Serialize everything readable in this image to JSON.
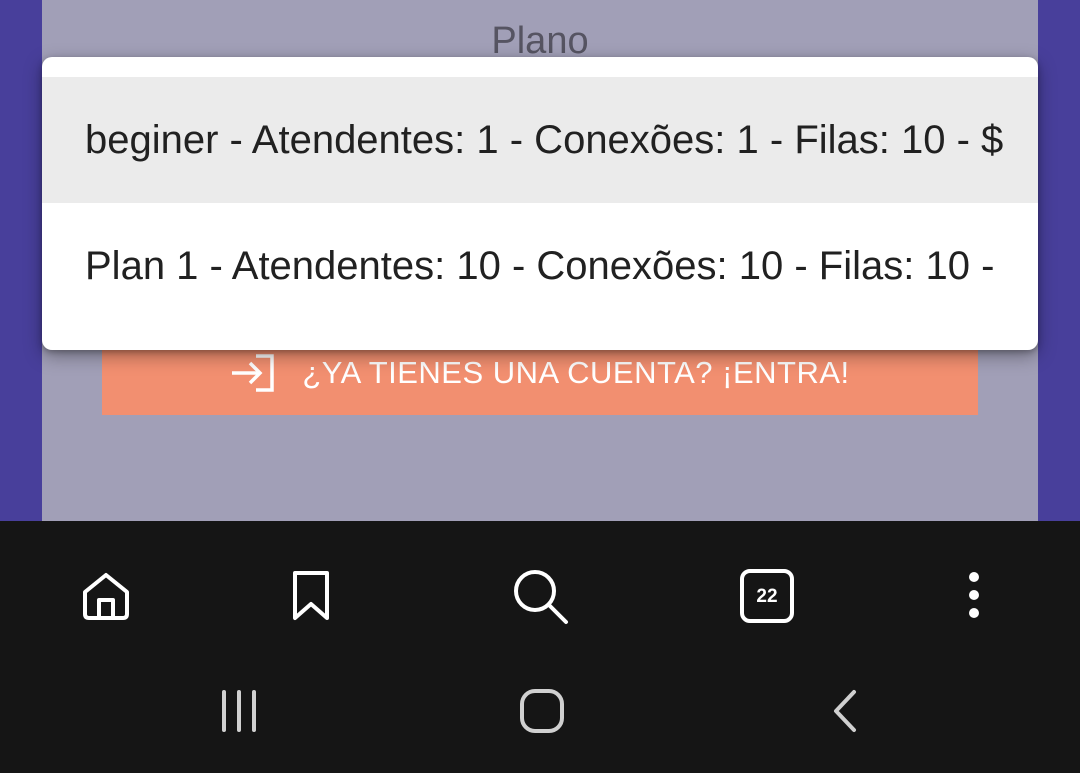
{
  "form": {
    "plan_label": "Plano",
    "login_button_label": "¿YA TIENES UNA CUENTA? ¡ENTRA!",
    "login_icon": "login-arrow-icon"
  },
  "plan_dropdown": {
    "options": [
      {
        "label": "beginer - Atendentes: 1 - Conexões: 1 - Filas: 10 - $",
        "highlighted": true
      },
      {
        "label": "Plan 1 - Atendentes: 10 - Conexões: 10 - Filas: 10 -",
        "highlighted": false
      }
    ]
  },
  "browser_toolbar": {
    "tab_count": "22",
    "icons": [
      "home-icon",
      "bookmark-icon",
      "search-icon",
      "tabs-icon",
      "more-vertical-icon"
    ]
  },
  "system_nav": {
    "icons": [
      "recent-apps-icon",
      "home-circle-icon",
      "back-icon"
    ]
  },
  "colors": {
    "background": "#483f9b",
    "card": "#a19fb7",
    "accent_button": "#f28f70",
    "toolbar": "#151515"
  }
}
